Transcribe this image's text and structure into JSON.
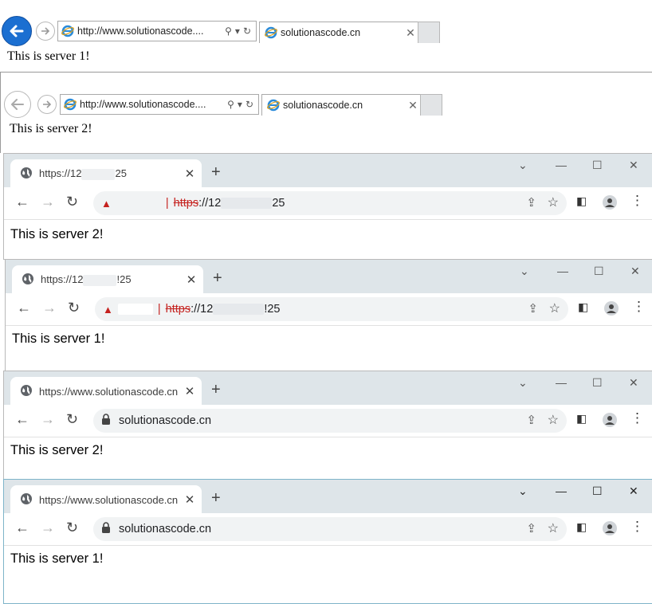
{
  "ie_windows": [
    {
      "url": "http://www.solutionascode....",
      "tab_title": "solutionascode.cn",
      "body_text": "This is server 1!"
    },
    {
      "url": "http://www.solutionascode....",
      "tab_title": "solutionascode.cn",
      "body_text": "This is server 2!"
    }
  ],
  "chrome_windows": [
    {
      "tab_title_prefix": "https://12",
      "tab_title_suffix": "25",
      "omni_scheme": "https",
      "omni_rest_prefix": "://12",
      "omni_rest_suffix": "25",
      "body_text": "This is server 2!"
    },
    {
      "tab_title_prefix": "https://12",
      "tab_title_suffix": "!25",
      "omni_scheme": "https",
      "omni_rest_prefix": "://12",
      "omni_rest_suffix": "!25",
      "body_text": "This is server 1!"
    },
    {
      "tab_title": "https://www.solutionascode.cn",
      "omni_text": "solutionascode.cn",
      "body_text": "This is server 2!"
    },
    {
      "tab_title": "https://www.solutionascode.cn",
      "omni_text": "solutionascode.cn",
      "body_text": "This is server 1!"
    }
  ],
  "icons": {
    "back": "←",
    "forward": "→",
    "reload": "↻",
    "close": "✕",
    "plus": "+",
    "minimize": "—",
    "maximize": "☐",
    "dropdown": "⌄",
    "star": "☆",
    "kebab": "⋮",
    "lock": "🔒",
    "warning": "▲",
    "search": "⚲"
  },
  "colors": {
    "ie_back_blue": "#1b6fd1",
    "chrome_frame": "#dee5e9",
    "insecure_red": "#c5221f"
  }
}
